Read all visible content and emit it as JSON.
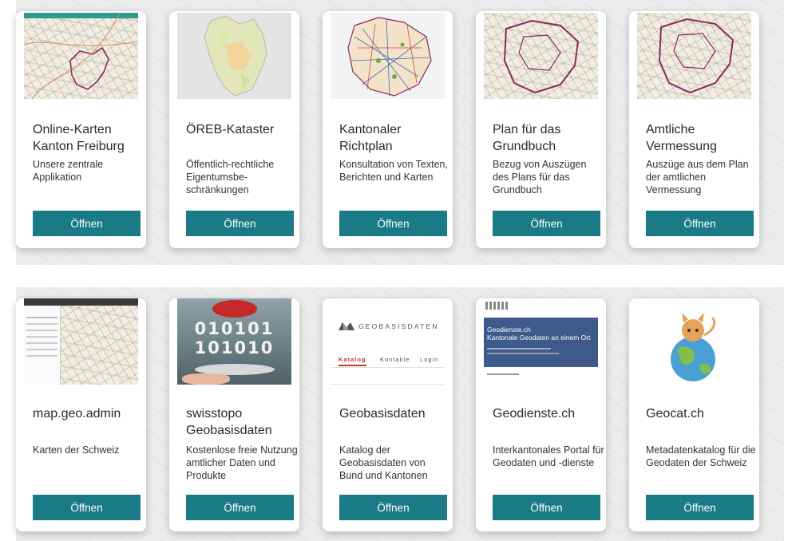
{
  "cards_row1": [
    {
      "title": "Online-Karten Kanton Freiburg",
      "desc": "Unsere zentrale Applikation",
      "button": "Öffnen",
      "thumb": "cantonal-map-thumbnail"
    },
    {
      "title": "ÖREB-Kataster",
      "desc": "Öffentlich-rechtliche Eigentumsbe-schränkungen",
      "button": "Öffnen",
      "thumb": "oereb-map-thumbnail"
    },
    {
      "title": "Kantonaler Richtplan",
      "desc": "Konsultation von Texten, Berichten und Karten",
      "button": "Öffnen",
      "thumb": "richtplan-map-thumbnail"
    },
    {
      "title": "Plan für das Grundbuch",
      "desc": "Bezug von Auszügen des Plans für das Grundbuch",
      "button": "Öffnen",
      "thumb": "grundbuch-map-thumbnail"
    },
    {
      "title": "Amtliche Vermessung",
      "desc": "Auszüge aus dem Plan der amtlichen Vermessung",
      "button": "Öffnen",
      "thumb": "vermessung-map-thumbnail"
    }
  ],
  "cards_row2": [
    {
      "title": "map.geo.admin",
      "desc": "Karten der Schweiz",
      "button": "Öffnen",
      "thumb": "map-geo-admin-screenshot"
    },
    {
      "title": "swisstopo Geobasisdaten",
      "desc": "Kostenlose freie Nutzung amtlicher Daten und Produkte",
      "button": "Öffnen",
      "thumb": "binary-gift-image",
      "thumb_text": [
        "010101",
        "101010"
      ]
    },
    {
      "title": "Geobasisdaten",
      "desc": "Katalog der Geobasisdaten von Bund und Kantonen",
      "button": "Öffnen",
      "thumb": "geobasisdaten-website-screenshot",
      "thumb_logo": "GEOBASISDATEN",
      "thumb_nav": [
        "Katalog",
        "Kontakte",
        "Login"
      ]
    },
    {
      "title": "Geodienste.ch",
      "desc": "Interkantonales Portal für Geodaten und -dienste",
      "button": "Öffnen",
      "thumb": "geodienste-website-screenshot",
      "thumb_heading": [
        "Geodienste.ch",
        "Kantonale Geodaten an einem Ort"
      ]
    },
    {
      "title": "Geocat.ch",
      "desc": "Metadatenkatalog für die Geodaten der Schweiz",
      "button": "Öffnen",
      "thumb": "geocat-cat-globe-illustration"
    }
  ],
  "colors": {
    "button": "#1a7b87",
    "band": "#ececec"
  }
}
